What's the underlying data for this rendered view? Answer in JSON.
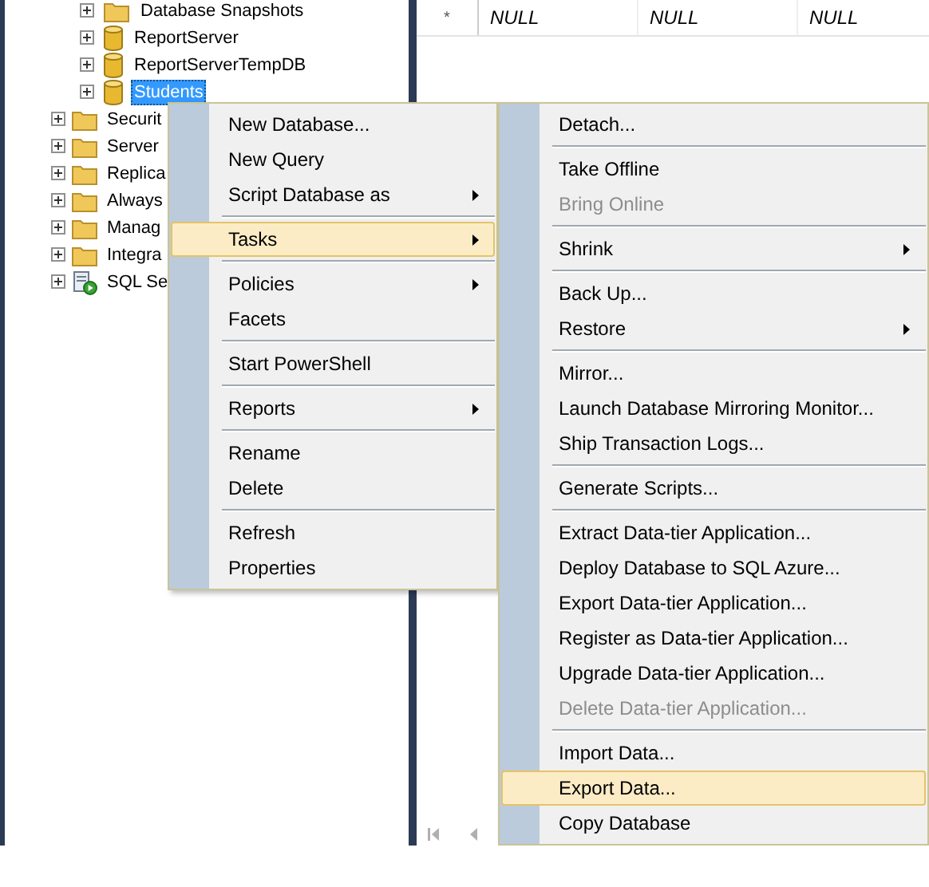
{
  "object_explorer": {
    "database_nodes": [
      {
        "label": "Database Snapshots",
        "kind": "folder",
        "expanded": false,
        "selected": false
      },
      {
        "label": "ReportServer",
        "kind": "database",
        "expanded": false,
        "selected": false
      },
      {
        "label": "ReportServerTempDB",
        "kind": "database",
        "expanded": false,
        "selected": false
      },
      {
        "label": "Students",
        "kind": "database",
        "expanded": false,
        "selected": true
      }
    ],
    "server_nodes": [
      {
        "label": "Securit",
        "kind": "folder",
        "expanded": false,
        "selected": false
      },
      {
        "label": "Server",
        "kind": "folder",
        "expanded": false,
        "selected": false
      },
      {
        "label": "Replica",
        "kind": "folder",
        "expanded": false,
        "selected": false
      },
      {
        "label": "Always",
        "kind": "folder",
        "expanded": false,
        "selected": false
      },
      {
        "label": "Manag",
        "kind": "folder",
        "expanded": false,
        "selected": false
      },
      {
        "label": "Integra",
        "kind": "folder",
        "expanded": false,
        "selected": false
      },
      {
        "label": "SQL Se",
        "kind": "agent",
        "expanded": false,
        "selected": false
      }
    ]
  },
  "grid": {
    "rows": [
      {
        "marker": "*",
        "cells": [
          "NULL",
          "NULL",
          "NULL"
        ]
      }
    ]
  },
  "menus": [
    {
      "items": [
        {
          "kind": "item",
          "label": "New Database...",
          "submenu": false,
          "disabled": false,
          "selected": false
        },
        {
          "kind": "item",
          "label": "New Query",
          "submenu": false,
          "disabled": false,
          "selected": false
        },
        {
          "kind": "item",
          "label": "Script Database as",
          "submenu": true,
          "disabled": false,
          "selected": false
        },
        {
          "kind": "separator"
        },
        {
          "kind": "item",
          "label": "Tasks",
          "submenu": true,
          "disabled": false,
          "selected": true
        },
        {
          "kind": "separator"
        },
        {
          "kind": "item",
          "label": "Policies",
          "submenu": true,
          "disabled": false,
          "selected": false
        },
        {
          "kind": "item",
          "label": "Facets",
          "submenu": false,
          "disabled": false,
          "selected": false
        },
        {
          "kind": "separator"
        },
        {
          "kind": "item",
          "label": "Start PowerShell",
          "submenu": false,
          "disabled": false,
          "selected": false
        },
        {
          "kind": "separator"
        },
        {
          "kind": "item",
          "label": "Reports",
          "submenu": true,
          "disabled": false,
          "selected": false
        },
        {
          "kind": "separator"
        },
        {
          "kind": "item",
          "label": "Rename",
          "submenu": false,
          "disabled": false,
          "selected": false
        },
        {
          "kind": "item",
          "label": "Delete",
          "submenu": false,
          "disabled": false,
          "selected": false
        },
        {
          "kind": "separator"
        },
        {
          "kind": "item",
          "label": "Refresh",
          "submenu": false,
          "disabled": false,
          "selected": false
        },
        {
          "kind": "item",
          "label": "Properties",
          "submenu": false,
          "disabled": false,
          "selected": false
        }
      ]
    },
    {
      "items": [
        {
          "kind": "item",
          "label": "Detach...",
          "submenu": false,
          "disabled": false,
          "selected": false
        },
        {
          "kind": "separator"
        },
        {
          "kind": "item",
          "label": "Take Offline",
          "submenu": false,
          "disabled": false,
          "selected": false
        },
        {
          "kind": "item",
          "label": "Bring Online",
          "submenu": false,
          "disabled": true,
          "selected": false
        },
        {
          "kind": "separator"
        },
        {
          "kind": "item",
          "label": "Shrink",
          "submenu": true,
          "disabled": false,
          "selected": false
        },
        {
          "kind": "separator"
        },
        {
          "kind": "item",
          "label": "Back Up...",
          "submenu": false,
          "disabled": false,
          "selected": false
        },
        {
          "kind": "item",
          "label": "Restore",
          "submenu": true,
          "disabled": false,
          "selected": false
        },
        {
          "kind": "separator"
        },
        {
          "kind": "item",
          "label": "Mirror...",
          "submenu": false,
          "disabled": false,
          "selected": false
        },
        {
          "kind": "item",
          "label": "Launch Database Mirroring Monitor...",
          "submenu": false,
          "disabled": false,
          "selected": false
        },
        {
          "kind": "item",
          "label": "Ship Transaction Logs...",
          "submenu": false,
          "disabled": false,
          "selected": false
        },
        {
          "kind": "separator"
        },
        {
          "kind": "item",
          "label": "Generate Scripts...",
          "submenu": false,
          "disabled": false,
          "selected": false
        },
        {
          "kind": "separator"
        },
        {
          "kind": "item",
          "label": "Extract Data-tier Application...",
          "submenu": false,
          "disabled": false,
          "selected": false
        },
        {
          "kind": "item",
          "label": "Deploy Database to SQL Azure...",
          "submenu": false,
          "disabled": false,
          "selected": false
        },
        {
          "kind": "item",
          "label": "Export Data-tier Application...",
          "submenu": false,
          "disabled": false,
          "selected": false
        },
        {
          "kind": "item",
          "label": "Register as Data-tier Application...",
          "submenu": false,
          "disabled": false,
          "selected": false
        },
        {
          "kind": "item",
          "label": "Upgrade Data-tier Application...",
          "submenu": false,
          "disabled": false,
          "selected": false
        },
        {
          "kind": "item",
          "label": "Delete Data-tier Application...",
          "submenu": false,
          "disabled": true,
          "selected": false
        },
        {
          "kind": "separator"
        },
        {
          "kind": "item",
          "label": "Import Data...",
          "submenu": false,
          "disabled": false,
          "selected": false
        },
        {
          "kind": "item",
          "label": "Export Data...",
          "submenu": false,
          "disabled": false,
          "selected": true
        },
        {
          "kind": "item",
          "label": "Copy Database",
          "submenu": false,
          "disabled": false,
          "selected": false
        }
      ]
    }
  ]
}
